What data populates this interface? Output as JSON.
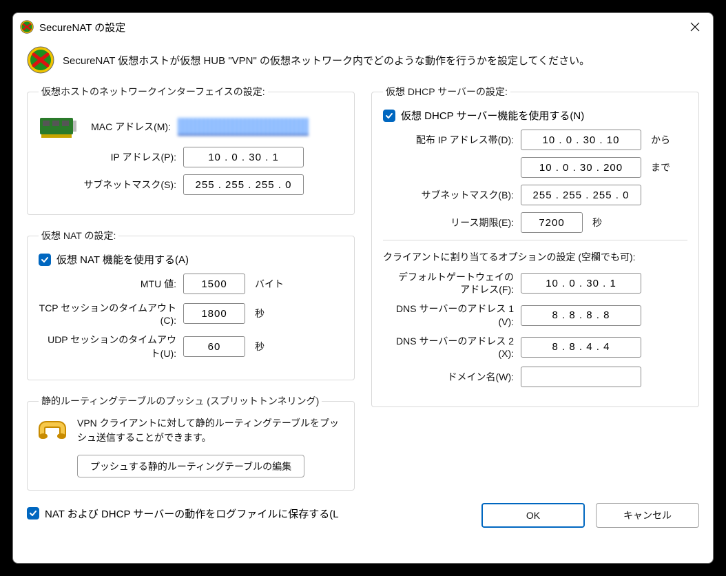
{
  "window": {
    "title": "SecureNAT の設定"
  },
  "intro": "SecureNAT 仮想ホストが仮想 HUB \"VPN\" の仮想ネットワーク内でどのような動作を行うかを設定してください。",
  "nic": {
    "legend": "仮想ホストのネットワークインターフェイスの設定:",
    "mac_label": "MAC アドレス(M):",
    "mac_value_redacted": true,
    "ip_label": "IP アドレス(P):",
    "ip_value": "10 . 0 . 30 . 1",
    "subnet_label": "サブネットマスク(S):",
    "subnet_value": "255 . 255 . 255 . 0"
  },
  "nat": {
    "legend": "仮想 NAT の設定:",
    "enable_label": "仮想 NAT 機能を使用する(A)",
    "enable_checked": true,
    "mtu_label": "MTU 値:",
    "mtu_value": "1500",
    "mtu_unit": "バイト",
    "tcp_label": "TCP セッションのタイムアウト(C):",
    "tcp_value": "1800",
    "tcp_unit": "秒",
    "udp_label": "UDP セッションのタイムアウト(U):",
    "udp_value": "60",
    "udp_unit": "秒"
  },
  "push": {
    "legend": "静的ルーティングテーブルのプッシュ (スプリットトンネリング)",
    "desc": "VPN クライアントに対して静的ルーティングテーブルをプッシュ送信することができます。",
    "button": "プッシュする静的ルーティングテーブルの編集"
  },
  "dhcp": {
    "legend": "仮想 DHCP サーバーの設定:",
    "enable_label": "仮想 DHCP サーバー機能を使用する(N)",
    "enable_checked": true,
    "range_label": "配布 IP アドレス帯(D):",
    "range_from": "10 . 0 . 30 . 10",
    "range_from_suffix": "から",
    "range_to": "10 . 0 . 30 . 200",
    "range_to_suffix": "まで",
    "subnet_label": "サブネットマスク(B):",
    "subnet_value": "255 . 255 . 255 . 0",
    "lease_label": "リース期限(E):",
    "lease_value": "7200",
    "lease_unit": "秒"
  },
  "options": {
    "heading": "クライアントに割り当てるオプションの設定 (空欄でも可):",
    "gw_label": "デフォルトゲートウェイの\nアドレス(F):",
    "gw_value": "10 . 0 . 30 . 1",
    "dns1_label": "DNS サーバーのアドレス 1 (V):",
    "dns1_value": "8 . 8 . 8 . 8",
    "dns2_label": "DNS サーバーのアドレス 2 (X):",
    "dns2_value": "8 . 8 . 4 . 4",
    "domain_label": "ドメイン名(W):",
    "domain_value": ""
  },
  "footer": {
    "log_label": "NAT および DHCP サーバーの動作をログファイルに保存する(L",
    "log_checked": true,
    "ok": "OK",
    "cancel": "キャンセル"
  }
}
